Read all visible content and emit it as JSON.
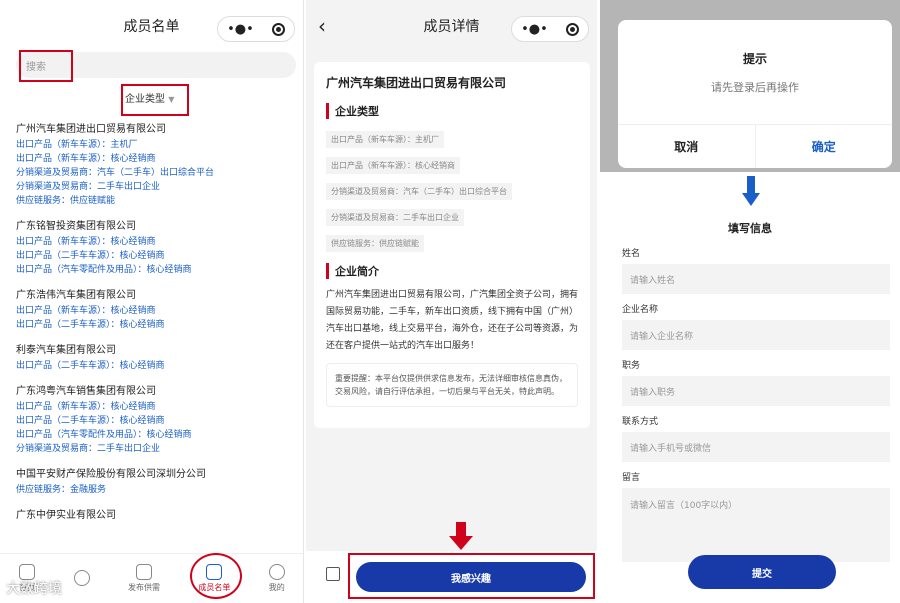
{
  "left": {
    "title": "成员名单",
    "more": "•●•",
    "search_placeholder": "搜索",
    "filter_label": "企业类型",
    "filter_arrow": "▼",
    "companies": [
      {
        "name": "广州汽车集团进出口贸易有限公司",
        "tags": [
          "出口产品（新车车源）：主机厂",
          "出口产品（新车车源）：核心经销商",
          "分销渠道及贸易商：汽车（二手车）出口综合平台",
          "分销渠道及贸易商：二手车出口企业",
          "供应链服务：供应链赋能"
        ]
      },
      {
        "name": "广东铭智投资集团有限公司",
        "tags": [
          "出口产品（新车车源）：核心经销商",
          "出口产品（二手车车源）：核心经销商",
          "出口产品（汽车零配件及用品）：核心经销商"
        ]
      },
      {
        "name": "广东浩伟汽车集团有限公司",
        "tags": [
          "出口产品（新车车源）：核心经销商",
          "出口产品（二手车车源）：核心经销商"
        ]
      },
      {
        "name": "利泰汽车集团有限公司",
        "tags": [
          "出口产品（二手车车源）：核心经销商"
        ]
      },
      {
        "name": "广东鸿粤汽车销售集团有限公司",
        "tags": [
          "出口产品（新车车源）：核心经销商",
          "出口产品（二手车车源）：核心经销商",
          "出口产品（汽车零配件及用品）：核心经销商",
          "分销渠道及贸易商：二手车出口企业"
        ]
      },
      {
        "name": "中国平安财产保险股份有限公司深圳分公司",
        "tags": [
          "供应链服务：金融服务"
        ]
      },
      {
        "name": "广东中伊实业有限公司",
        "tags": []
      }
    ],
    "tabs": [
      "首页",
      "",
      "发布供需",
      "成员名单",
      "我的"
    ],
    "watermark": "大数跨境"
  },
  "middle": {
    "title": "成员详情",
    "back": "‹",
    "more": "•●•",
    "company": "广州汽车集团进出口贸易有限公司",
    "type_heading": "企业类型",
    "types": [
      "出口产品（新车车源）：主机厂",
      "出口产品（新车车源）：核心经销商",
      "分销渠道及贸易商：汽车（二手车）出口综合平台",
      "分销渠道及贸易商：二手车出口企业",
      "供应链服务：供应链赋能"
    ],
    "intro_heading": "企业简介",
    "intro": "广州汽车集团进出口贸易有限公司，广汽集团全资子公司，拥有国际贸易功能，二手车，新车出口资质，线下拥有中国（广州）汽车出口基地，线上交易平台，海外仓，还在子公司等资源，为还在客户提供一站式的汽车出口服务！",
    "notice": "重要提醒：本平台仅提供供求信息发布，无法详细审核信息真伪，交易风险，请自行评估承担，一切后果与平台无关，特此声明。",
    "interest_button": "我感兴趣"
  },
  "right": {
    "dialog_title": "提示",
    "dialog_message": "请先登录后再操作",
    "cancel": "取消",
    "confirm": "确定",
    "form_title": "填写信息",
    "fields": [
      {
        "label": "姓名",
        "placeholder": "请输入姓名"
      },
      {
        "label": "企业名称",
        "placeholder": "请输入企业名称"
      },
      {
        "label": "职务",
        "placeholder": "请输入职务"
      },
      {
        "label": "联系方式",
        "placeholder": "请输入手机号或微信"
      },
      {
        "label": "留言",
        "placeholder": "请输入留言（100字以内）"
      }
    ],
    "submit": "提交"
  },
  "colors": {
    "accent_red": "#d0021b",
    "link_blue": "#1a5fc8",
    "button_blue": "#173aa8"
  }
}
